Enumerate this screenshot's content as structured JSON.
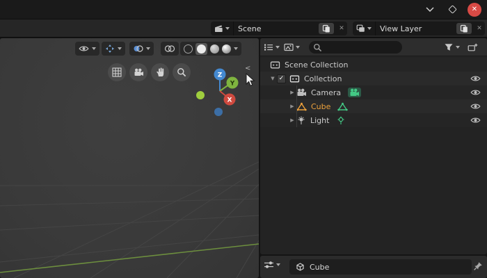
{
  "window": {
    "controls": {
      "minimize_icon": "chevron-down",
      "maximize_icon": "diamond",
      "close_icon": "✕"
    }
  },
  "topbar": {
    "scene_selector": {
      "value": "Scene"
    },
    "view_layer_selector": {
      "value": "View Layer"
    }
  },
  "viewport": {
    "gizmo": {
      "x_label": "X",
      "y_label": "Y",
      "z_label": "Z"
    },
    "collapse_arrow": "<"
  },
  "outliner": {
    "search": {
      "placeholder": ""
    },
    "tree": [
      {
        "label": "Scene Collection",
        "icon": "scene-collection"
      },
      {
        "label": "Collection",
        "icon": "collection",
        "checked": true,
        "expanded": true,
        "visible": true
      },
      {
        "label": "Camera",
        "icon": "camera",
        "data_icon": "camera-data",
        "visible": true
      },
      {
        "label": "Cube",
        "icon": "mesh-triangle",
        "data_icon": "mesh-data",
        "selected": true,
        "visible": true
      },
      {
        "label": "Light",
        "icon": "light",
        "data_icon": "light-data",
        "visible": true
      }
    ]
  },
  "properties": {
    "breadcrumb": {
      "label": "Cube",
      "icon": "object-cube"
    }
  },
  "glyphs": {
    "check": "✓",
    "tri_down": "▼",
    "tri_right": "▶",
    "close_small": "✕"
  },
  "colors": {
    "accent_orange": "#eda13c",
    "axis_x_red": "#cf4a3f",
    "axis_y_green": "#7fb43f",
    "axis_z_blue": "#4489d0",
    "data_green": "#43c985",
    "close_red": "#d84a45"
  }
}
